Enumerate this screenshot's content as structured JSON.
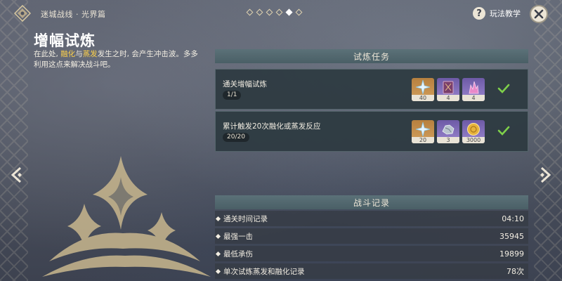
{
  "header": {
    "breadcrumb": "迷城战线 · 光界篇",
    "page_dots_total": 6,
    "page_dots_active_index": 4,
    "help_label": "玩法教学"
  },
  "intro": {
    "title": "增幅试炼",
    "desc_part1": "在此处, ",
    "desc_hl1": "融化",
    "desc_part2": "与",
    "desc_hl2": "蒸发",
    "desc_part3": "发生之时, 会产生冲击波。多多利用这点来解决战斗吧。"
  },
  "tasks": {
    "header": "试炼任务",
    "items": [
      {
        "title": "通关增幅试炼",
        "progress": "1/1",
        "completed": true,
        "rewards": [
          {
            "icon": "primogem-icon",
            "count": "40"
          },
          {
            "icon": "talent-book-icon",
            "count": "4"
          },
          {
            "icon": "crystal-icon",
            "count": "4"
          }
        ]
      },
      {
        "title": "累计触发20次融化或蒸发反应",
        "progress": "20/20",
        "completed": true,
        "rewards": [
          {
            "icon": "primogem-icon",
            "count": "20"
          },
          {
            "icon": "ore-icon",
            "count": "3"
          },
          {
            "icon": "mora-icon",
            "count": "3000"
          }
        ]
      }
    ]
  },
  "records": {
    "header": "战斗记录",
    "rows": [
      {
        "label": "通关时间记录",
        "value": "04:10"
      },
      {
        "label": "最强一击",
        "value": "35945"
      },
      {
        "label": "最低承伤",
        "value": "19899"
      },
      {
        "label": "单次试炼蒸发和融化记录",
        "value": "78次"
      }
    ]
  },
  "colors": {
    "accent_highlight": "#ffd24a",
    "check_green": "#7ed04a",
    "panel_header": "#5b7178",
    "reward_gold": "#c38f4c",
    "reward_purple": "#7f6bb9"
  }
}
